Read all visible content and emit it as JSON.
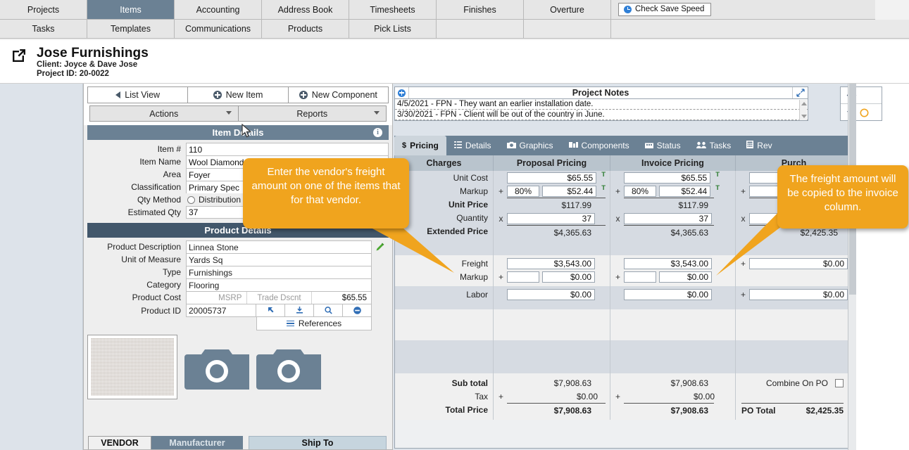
{
  "topnav": {
    "row1": [
      "Projects",
      "Items",
      "Accounting",
      "Address Book",
      "Timesheets",
      "Finishes",
      "Overture"
    ],
    "row2": [
      "Tasks",
      "Templates",
      "Communications",
      "Products",
      "Pick Lists",
      "",
      ""
    ],
    "active_tab": "Items",
    "save_speed_button": "Check Save Speed",
    "save_speed_icon": "clock-icon"
  },
  "project_header": {
    "open_icon": "external-link-icon",
    "title": "Jose Furnishings",
    "client_line": "Client: Joyce & Dave Jose",
    "project_id_line": "Project ID: 20-0022"
  },
  "toolbar": {
    "list_view": "List View",
    "new_item": "New Item",
    "new_component": "New Component",
    "actions": "Actions",
    "reports": "Reports"
  },
  "item_details": {
    "header": "Item Details",
    "info_icon": "info-icon",
    "fields": [
      {
        "label": "Item #",
        "value": "110"
      },
      {
        "label": "Item Name",
        "value": "Wool Diamond"
      },
      {
        "label": "Area",
        "value": "Foyer"
      },
      {
        "label": "Classification",
        "value": "Primary Spec"
      },
      {
        "label": "Qty Method",
        "value": "Distribution"
      },
      {
        "label": "Estimated Qty",
        "value": "37"
      }
    ]
  },
  "product_details": {
    "header": "Product Details",
    "edit_icon": "pencil-icon",
    "description_label": "Product Description",
    "description_value": "Linnea Stone",
    "uom_label": "Unit of Measure",
    "uom_value": "Yards Sq",
    "type_label": "Type",
    "type_value": "Furnishings",
    "category_label": "Category",
    "category_value": "Flooring",
    "cost_label": "Product Cost",
    "cost_msrp": "MSRP",
    "cost_trade": "Trade Dscnt",
    "cost_value": "$65.55",
    "product_id_label": "Product ID",
    "product_id_value": "20005737",
    "id_buttons": [
      "arrow-up-left-icon",
      "download-icon",
      "search-icon",
      "minus-circle-icon"
    ],
    "references_label": "References",
    "references_icon": "list-icon"
  },
  "media": {
    "swatch": "product-swatch-thumbnail",
    "camera_icon_1": "camera-icon",
    "camera_icon_2": "camera-icon"
  },
  "bottom_tabs": {
    "vendor": "VENDOR",
    "manufacturer": "Manufacturer",
    "ship_to": "Ship To",
    "active": "VENDOR"
  },
  "project_notes": {
    "add_icon": "plus-circle-icon",
    "title": "Project Notes",
    "expand_icon": "expand-diagonal-icon",
    "notes": [
      "4/5/2021 - FPN - They want an earlier installation date.",
      "3/30/2021 - FPN - Client will be out of the country in June."
    ]
  },
  "side_box": {
    "tag_icon": "tag-icon",
    "star_icon": "star-icon"
  },
  "pricing_tabs": [
    {
      "label": "Pricing",
      "icon": "dollar-icon",
      "active": true
    },
    {
      "label": "Details",
      "icon": "list-icon",
      "active": false
    },
    {
      "label": "Graphics",
      "icon": "camera-icon",
      "active": false
    },
    {
      "label": "Components",
      "icon": "components-icon",
      "active": false
    },
    {
      "label": "Status",
      "icon": "calendar-icon",
      "active": false
    },
    {
      "label": "Tasks",
      "icon": "people-icon",
      "active": false
    },
    {
      "label": "Rev",
      "icon": "book-icon",
      "active": false
    }
  ],
  "pricing_grid": {
    "columns": [
      "Charges",
      "Proposal Pricing",
      "Invoice Pricing",
      "Purch"
    ],
    "rows": {
      "unit_cost": {
        "label": "Unit Cost",
        "proposal": "$65.55",
        "invoice": "$65.55",
        "purchase": "",
        "tax_flag": "T"
      },
      "markup": {
        "label": "Markup",
        "proposal_pct": "80%",
        "proposal": "$52.44",
        "invoice_pct": "80%",
        "invoice": "$52.44",
        "purchase_pct": "",
        "purchase": "",
        "op": "+",
        "tax_flag": "T"
      },
      "unit_price": {
        "label": "Unit Price",
        "proposal": "$117.99",
        "invoice": "$117.99",
        "purchase": ""
      },
      "quantity": {
        "label": "Quantity",
        "proposal": "37",
        "invoice": "37",
        "purchase": "",
        "op": "x"
      },
      "extended_price": {
        "label": "Extended Price",
        "proposal": "$4,365.63",
        "invoice": "$4,365.63",
        "purchase": "$2,425.35"
      },
      "freight": {
        "label": "Freight",
        "proposal": "$3,543.00",
        "invoice": "$3,543.00",
        "purchase": "$0.00",
        "op": "+"
      },
      "freight_markup": {
        "label": "Markup",
        "proposal_pct": "",
        "proposal": "$0.00",
        "invoice_pct": "",
        "invoice": "$0.00",
        "op": "+"
      },
      "labor": {
        "label": "Labor",
        "proposal": "$0.00",
        "invoice": "$0.00",
        "purchase": "$0.00",
        "op": "+"
      },
      "sub_total": {
        "label": "Sub total",
        "proposal": "$7,908.63",
        "invoice": "$7,908.63"
      },
      "tax": {
        "label": "Tax",
        "proposal": "$0.00",
        "invoice": "$0.00",
        "op": "+"
      },
      "total_price": {
        "label": "Total Price",
        "proposal": "$7,908.63",
        "invoice": "$7,908.63"
      }
    },
    "combine_on_po_label": "Combine On PO",
    "combine_on_po_checked": false,
    "po_total_label": "PO Total",
    "po_total_value": "$2,425.35"
  },
  "callouts": {
    "left": "Enter the vendor's freight amount on one of the items that for that vendor.",
    "right": "The freight amount will be copied to the invoice column.",
    "color": "#f0a41e"
  },
  "colors": {
    "accent_header": "#6b8194",
    "accent_header_dark": "#42576b",
    "callout": "#f0a41e",
    "tax_flag": "#2e7d32",
    "link_blue": "#2f6db5"
  }
}
